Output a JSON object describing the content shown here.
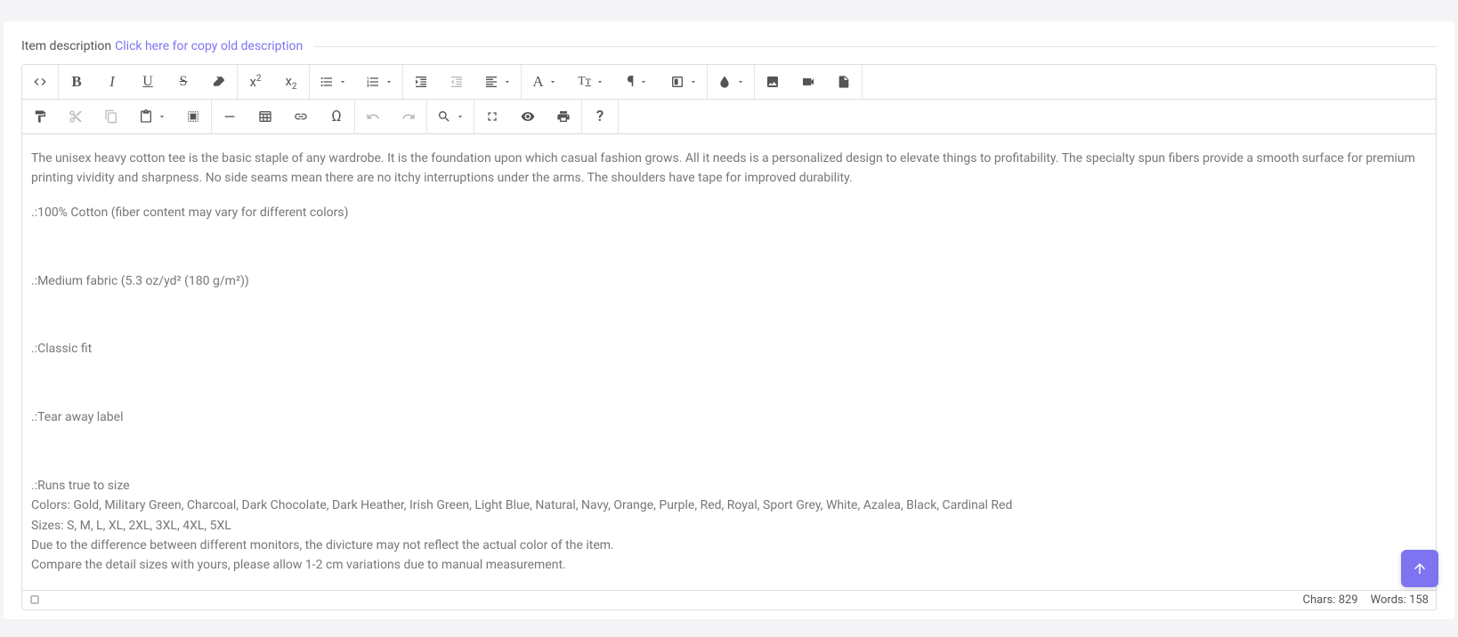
{
  "header": {
    "label": "Item description",
    "link": "Click here for copy old description"
  },
  "content": {
    "intro": "The unisex heavy cotton tee is the basic staple of any wardrobe. It is the foundation upon which casual fashion grows. All it needs is a personalized design to elevate things to profitability. The specialty spun fibers provide a smooth surface for premium printing vividity and sharpness. No side seams mean there are no itchy interruptions under the arms. The shoulders have tape for improved durability.",
    "bullet1": ".:100% Cotton (fiber content may vary for different colors)",
    "bullet2": ".:Medium fabric (5.3 oz/yd² (180 g/m²))",
    "bullet3": ".:Classic fit",
    "bullet4": ".:Tear away label",
    "bullet5": ".:Runs true to size",
    "colors": "Colors: Gold, Military Green, Charcoal, Dark Chocolate, Dark Heather, Irish Green, Light Blue, Natural, Navy, Orange, Purple, Red, Royal, Sport Grey, White, Azalea, Black, Cardinal Red",
    "sizes": "Sizes: S, M, L, XL, 2XL, 3XL, 4XL, 5XL",
    "note1": "Due to the difference between different monitors, the divicture may not reflect the actual color of the item.",
    "note2": "Compare the detail sizes with yours, please allow 1-2 cm variations due to manual measurement."
  },
  "footer": {
    "chars": "Chars: 829",
    "words": "Words: 158"
  }
}
